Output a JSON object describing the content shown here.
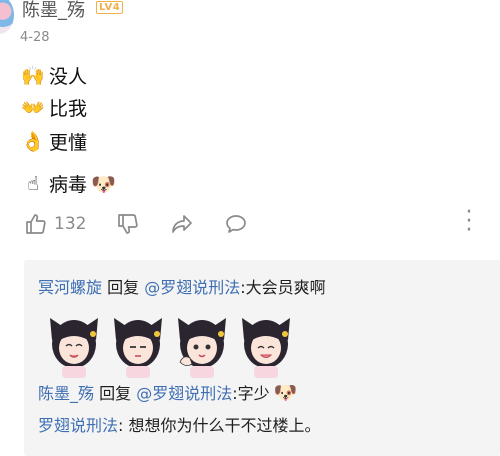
{
  "comment": {
    "username": "陈墨_殇",
    "level_badge": "LV4",
    "date": "4-28",
    "lines": [
      {
        "emoji": "🙌",
        "text": "没人"
      },
      {
        "emoji": "👐",
        "text": "比我"
      },
      {
        "emoji": "👌",
        "text": "更懂"
      },
      {
        "emoji": "☝",
        "text": "病毒",
        "trailing_emoji": "🐶"
      }
    ],
    "like_count": "132"
  },
  "icons": {
    "avatar": "anime-avatar",
    "like": "thumbs-up-icon",
    "dislike": "thumbs-down-icon",
    "share": "share-icon",
    "reply": "comment-bubble-icon",
    "more": "more-vertical-icon"
  },
  "replies": [
    {
      "author": "冥河螺旋",
      "verb": " 回复 ",
      "target": "@罗翅说刑法",
      "text": ":大会员爽啊"
    },
    {
      "author": "陈墨_殇",
      "verb": " 回复 ",
      "target": "@罗翅说刑法",
      "text": ":字少",
      "trailing_emoji": "🐶"
    },
    {
      "author": "罗翅说刑法",
      "verb": "",
      "target": "",
      "text": ": 想想你为什么干不过楼上。"
    }
  ],
  "colors": {
    "link_blue": "#3f6fb3",
    "badge_orange": "#f0b04a",
    "reply_bg": "#f4f4f4"
  }
}
